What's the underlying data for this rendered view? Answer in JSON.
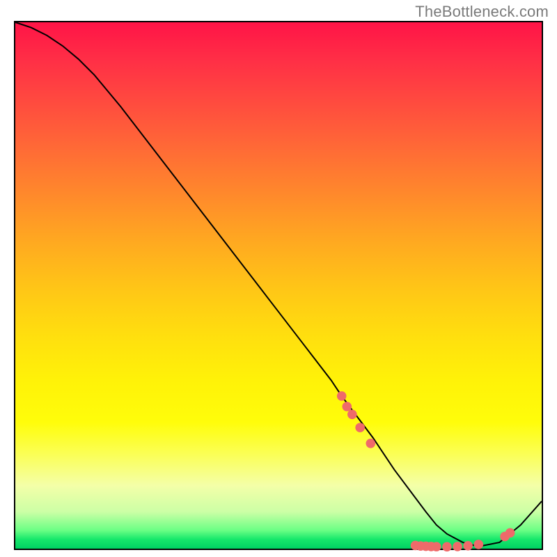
{
  "attribution": "TheBottleneck.com",
  "chart_data": {
    "type": "line",
    "title": "",
    "xlabel": "",
    "ylabel": "",
    "xlim": [
      0,
      100
    ],
    "ylim": [
      0,
      100
    ],
    "grid": false,
    "legend": false,
    "series": [
      {
        "name": "curve",
        "x": [
          0,
          3,
          6,
          9,
          12,
          15,
          20,
          25,
          30,
          35,
          40,
          45,
          50,
          55,
          60,
          62,
          65,
          68,
          70,
          72,
          75,
          78,
          80,
          82,
          85,
          88,
          92,
          96,
          100
        ],
        "y": [
          100,
          99,
          97.5,
          95.5,
          93,
          90,
          84,
          77.5,
          71,
          64.5,
          58,
          51.5,
          45,
          38.5,
          32,
          29,
          25,
          21,
          18,
          15,
          11,
          7,
          4.5,
          2.8,
          1.2,
          0.4,
          1.2,
          4.5,
          9
        ]
      }
    ],
    "markers": {
      "name": "dotted-segments",
      "color": "#ef6a6a",
      "points": [
        {
          "x": 62.0,
          "y": 29.0
        },
        {
          "x": 63.0,
          "y": 27.0
        },
        {
          "x": 64.0,
          "y": 25.5
        },
        {
          "x": 65.5,
          "y": 23.0
        },
        {
          "x": 67.5,
          "y": 20.0
        },
        {
          "x": 76.0,
          "y": 0.6
        },
        {
          "x": 77.0,
          "y": 0.5
        },
        {
          "x": 78.0,
          "y": 0.45
        },
        {
          "x": 79.0,
          "y": 0.4
        },
        {
          "x": 80.0,
          "y": 0.38
        },
        {
          "x": 82.0,
          "y": 0.35
        },
        {
          "x": 84.0,
          "y": 0.4
        },
        {
          "x": 86.0,
          "y": 0.55
        },
        {
          "x": 88.0,
          "y": 0.8
        },
        {
          "x": 93.0,
          "y": 2.3
        },
        {
          "x": 94.0,
          "y": 3.0
        }
      ]
    },
    "colors": {
      "curve": "#000000",
      "marker": "#ef6a6a",
      "gradient_top": "#ff1447",
      "gradient_bottom": "#00d263"
    }
  }
}
